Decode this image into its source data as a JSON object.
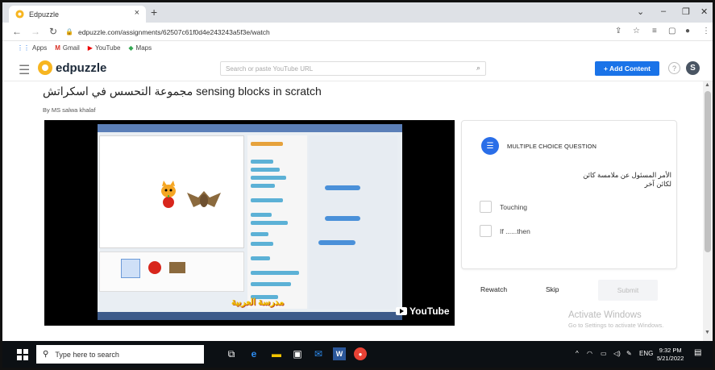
{
  "browser": {
    "tab_title": "Edpuzzle",
    "tab_close": "×",
    "new_tab": "+",
    "url": "edpuzzle.com/assignments/62507c61f0d4e243243a5f3e/watch",
    "bookmarks": [
      {
        "label": "Apps",
        "icon": "apps-icon"
      },
      {
        "label": "Gmail",
        "icon": "gmail-icon"
      },
      {
        "label": "YouTube",
        "icon": "youtube-icon"
      },
      {
        "label": "Maps",
        "icon": "maps-icon"
      }
    ]
  },
  "app": {
    "logo_text": "edpuzzle",
    "search_placeholder": "Search or paste YouTube URL",
    "add_content_label": "+ Add Content",
    "help_label": "?",
    "avatar_initial": "S"
  },
  "lesson": {
    "title": "مجموعة التحسس في اسكراتش sensing blocks in scratch",
    "byline": "By MS salwa khalaf",
    "video_overlay_text": "مدرسة العربية",
    "youtube_label": "YouTube"
  },
  "question": {
    "type_label": "MULTIPLE CHOICE QUESTION",
    "text": "الأمر المسئول عن ملامسة كائن لكائن آخر",
    "options": [
      "Touching",
      "If ......then"
    ]
  },
  "actions": {
    "rewatch": "Rewatch",
    "skip": "Skip",
    "submit": "Submit"
  },
  "watermark": {
    "line1": "Activate Windows",
    "line2": "Go to Settings to activate Windows."
  },
  "taskbar": {
    "search_placeholder": "Type here to search",
    "lang": "ENG",
    "time": "9:32 PM",
    "date": "5/21/2022"
  },
  "colors": {
    "accent": "#1a73e8",
    "question_icon": "#2a6ee8",
    "logo": "#f7b520",
    "taskbar": "#0c1014"
  }
}
